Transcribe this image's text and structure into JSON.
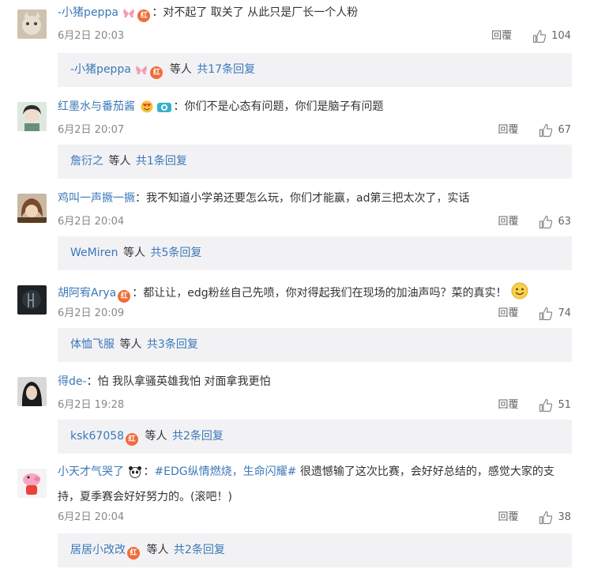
{
  "comments": [
    {
      "user": "-小猪peppa",
      "text": "：对不起了 取关了 从此只是厂长一个人粉",
      "date": "6月2日 20:03",
      "reply_label": "回覆",
      "likes": "104",
      "sub_user": "-小猪peppa",
      "sub_mid": "等人",
      "sub_total": "共17条回复"
    },
    {
      "user": "红墨水与番茄酱",
      "text": "：你们不是心态有问题，你们是脑子有问题",
      "date": "6月2日 20:07",
      "reply_label": "回覆",
      "likes": "67",
      "sub_user": "詹衍之",
      "sub_mid": "等人",
      "sub_total": "共1条回复"
    },
    {
      "user": "鸡叫一声撅一撅",
      "text": "：我不知道小学弟还要怎么玩，你们才能赢，ad第三把太次了，实话",
      "date": "6月2日 20:04",
      "reply_label": "回覆",
      "likes": "63",
      "sub_user": "WeMiren",
      "sub_mid": "等人",
      "sub_total": "共5条回复"
    },
    {
      "user": "胡阿宥Arya",
      "text": "：都让让，edg粉丝自己先喷，你对得起我们在现场的加油声吗？菜的真实！",
      "date": "6月2日 20:09",
      "reply_label": "回覆",
      "likes": "74",
      "sub_user": "体恤飞服",
      "sub_mid": "等人",
      "sub_total": "共3条回复"
    },
    {
      "user": "得de-",
      "text": "：怕 我队拿骚英雄我怕 对面拿我更怕",
      "date": "6月2日 19:28",
      "reply_label": "回覆",
      "likes": "51",
      "sub_user": "ksk67058",
      "sub_mid": "等人",
      "sub_total": "共2条回复"
    },
    {
      "user": "小天才气哭了",
      "tag": "#EDG纵情燃烧，生命闪耀#",
      "text_prefix": "：",
      "text": " 很遗憾输了这次比赛，会好好总结的，感觉大家的支持，夏季赛会好好努力的。(滚吧！)",
      "date": "6月2日 20:04",
      "reply_label": "回覆",
      "likes": "38",
      "sub_user": "居居小改改",
      "sub_mid": "等人",
      "sub_total": "共2条回复"
    }
  ],
  "badge_label": "红",
  "colors": {
    "username": "#eb7350",
    "link": "#3b78b7",
    "subbox_bg": "#f2f2f5",
    "meta": "#888888"
  },
  "icons": {
    "like": "thumbs-up-icon",
    "badge": "red-v-badge-icon",
    "butterfly": "butterfly-icon",
    "smile": "smile-emoji-icon",
    "heart_eyes": "heart-eyes-emoji-icon",
    "camera": "camera-icon",
    "panda": "panda-icon"
  }
}
